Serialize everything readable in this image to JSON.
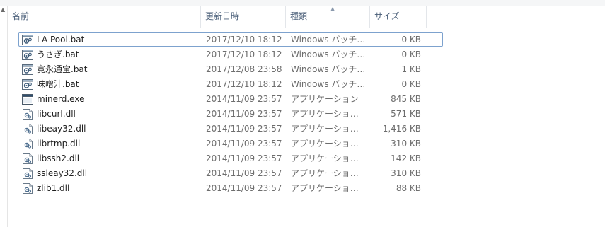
{
  "columns": {
    "name": "名前",
    "date": "更新日時",
    "type": "種類",
    "size": "サイズ"
  },
  "files": [
    {
      "name": "LA Pool.bat",
      "date": "2017/12/10 18:12",
      "type": "Windows バッチ…",
      "size": "0 KB",
      "icon": "batch-file-icon"
    },
    {
      "name": "うさぎ.bat",
      "date": "2017/12/10 18:12",
      "type": "Windows バッチ…",
      "size": "0 KB",
      "icon": "batch-file-icon"
    },
    {
      "name": "寛永通宝.bat",
      "date": "2017/12/08 23:58",
      "type": "Windows バッチ…",
      "size": "1 KB",
      "icon": "batch-file-icon"
    },
    {
      "name": "味噌汁.bat",
      "date": "2017/12/10 18:12",
      "type": "Windows バッチ…",
      "size": "0 KB",
      "icon": "batch-file-icon"
    },
    {
      "name": "minerd.exe",
      "date": "2014/11/09 23:57",
      "type": "アプリケーション",
      "size": "845 KB",
      "icon": "exe-file-icon"
    },
    {
      "name": "libcurl.dll",
      "date": "2014/11/09 23:57",
      "type": "アプリケーショ…",
      "size": "571 KB",
      "icon": "dll-file-icon"
    },
    {
      "name": "libeay32.dll",
      "date": "2014/11/09 23:57",
      "type": "アプリケーショ…",
      "size": "1,416 KB",
      "icon": "dll-file-icon"
    },
    {
      "name": "librtmp.dll",
      "date": "2014/11/09 23:57",
      "type": "アプリケーショ…",
      "size": "310 KB",
      "icon": "dll-file-icon"
    },
    {
      "name": "libssh2.dll",
      "date": "2014/11/09 23:57",
      "type": "アプリケーショ…",
      "size": "142 KB",
      "icon": "dll-file-icon"
    },
    {
      "name": "ssleay32.dll",
      "date": "2014/11/09 23:57",
      "type": "アプリケーショ…",
      "size": "310 KB",
      "icon": "dll-file-icon"
    },
    {
      "name": "zlib1.dll",
      "date": "2014/11/09 23:57",
      "type": "アプリケーショ…",
      "size": "88 KB",
      "icon": "dll-file-icon"
    }
  ]
}
